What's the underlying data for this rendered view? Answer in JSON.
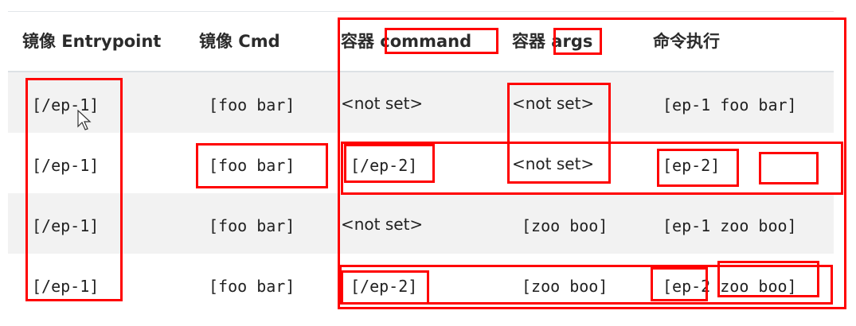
{
  "table": {
    "headers": [
      "镜像 Entrypoint",
      "镜像 Cmd",
      "容器 command",
      "容器 args",
      "命令执行"
    ],
    "rows": [
      [
        "[/ep-1]",
        "[foo bar]",
        "<not set>",
        "<not set>",
        "[ep-1 foo bar]"
      ],
      [
        "[/ep-1]",
        "[foo bar]",
        "[/ep-2]",
        "<not set>",
        "[ep-2]"
      ],
      [
        "[/ep-1]",
        "[foo bar]",
        "<not set>",
        "[zoo boo]",
        "[ep-1 zoo boo]"
      ],
      [
        "[/ep-1]",
        "[foo bar]",
        "[/ep-2]",
        "[zoo boo]",
        "[ep-2 zoo boo]"
      ]
    ]
  },
  "colors": {
    "annotation": "#ff0000",
    "stripe": "#f2f2f2"
  },
  "icons": {
    "cursor": "mouse-pointer-icon"
  }
}
